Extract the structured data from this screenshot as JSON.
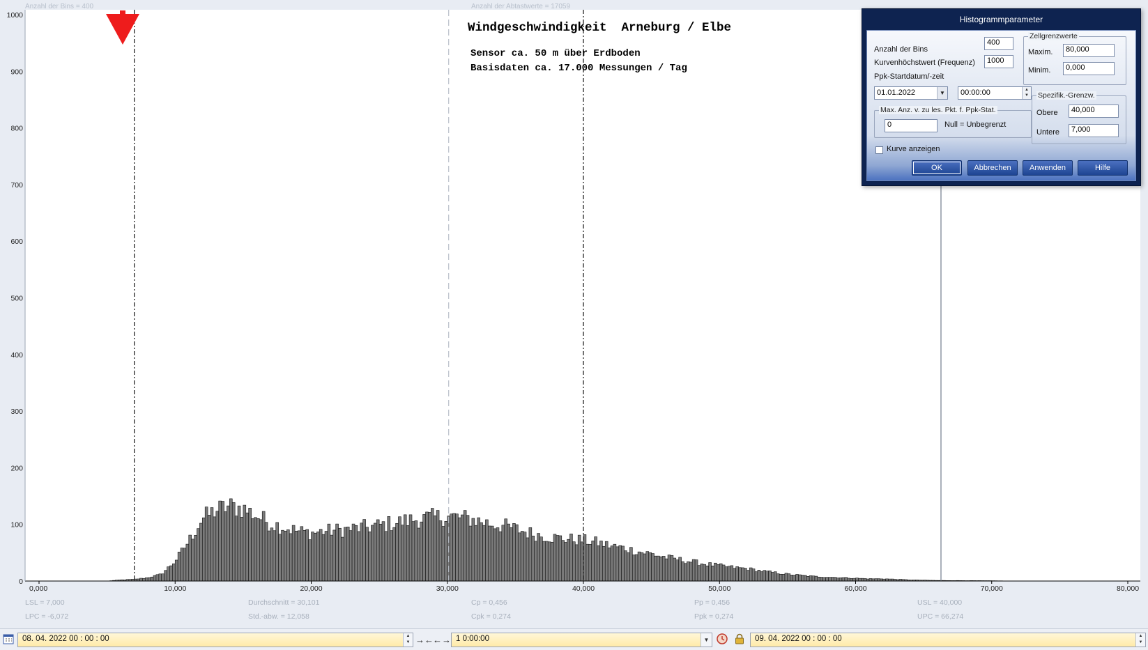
{
  "chart_data": {
    "type": "bar",
    "title": "Windgeschwindigkeit  Arneburg / Elbe",
    "subtitle_lines": [
      "Sensor ca. 50 m über Erdboden",
      "Basisdaten ca. 17.000 Messungen / Tag"
    ],
    "ghost_labels": {
      "bins": "Anzahl der Bins =   400",
      "samples": "Anzahl der Abtastwerte = 17059"
    },
    "xlim": [
      0,
      80
    ],
    "ylim": [
      0,
      1000
    ],
    "x_ticks": [
      0,
      10,
      20,
      30,
      40,
      50,
      60,
      70,
      80
    ],
    "x_tick_labels": [
      "0,000",
      "10,000",
      "20,000",
      "30,000",
      "40,000",
      "50,000",
      "60,000",
      "70,000",
      "80,000"
    ],
    "y_ticks": [
      0,
      100,
      200,
      300,
      400,
      500,
      600,
      700,
      800,
      900,
      1000
    ],
    "y_tick_labels": [
      "0",
      "100",
      "200",
      "300",
      "400",
      "500",
      "600",
      "700",
      "800",
      "900",
      "1000"
    ],
    "bin_width": 0.2,
    "profile": [
      [
        5,
        0
      ],
      [
        6,
        2
      ],
      [
        7,
        3
      ],
      [
        8,
        6
      ],
      [
        9,
        12
      ],
      [
        10,
        35
      ],
      [
        11,
        70
      ],
      [
        12,
        110
      ],
      [
        13,
        125
      ],
      [
        14,
        132
      ],
      [
        15,
        128
      ],
      [
        16,
        115
      ],
      [
        17,
        102
      ],
      [
        18,
        95
      ],
      [
        19,
        88
      ],
      [
        20,
        85
      ],
      [
        21,
        88
      ],
      [
        22,
        90
      ],
      [
        23,
        92
      ],
      [
        24,
        95
      ],
      [
        25,
        98
      ],
      [
        26,
        102
      ],
      [
        27,
        106
      ],
      [
        28,
        110
      ],
      [
        29,
        112
      ],
      [
        30,
        114
      ],
      [
        31,
        112
      ],
      [
        32,
        108
      ],
      [
        33,
        102
      ],
      [
        34,
        98
      ],
      [
        35,
        92
      ],
      [
        36,
        85
      ],
      [
        37,
        80
      ],
      [
        38,
        76
      ],
      [
        39,
        74
      ],
      [
        40,
        72
      ],
      [
        41,
        68
      ],
      [
        42,
        62
      ],
      [
        43,
        58
      ],
      [
        44,
        52
      ],
      [
        45,
        48
      ],
      [
        46,
        42
      ],
      [
        47,
        38
      ],
      [
        48,
        34
      ],
      [
        49,
        30
      ],
      [
        50,
        27
      ],
      [
        51,
        24
      ],
      [
        52,
        22
      ],
      [
        53,
        18
      ],
      [
        54,
        15
      ],
      [
        55,
        12
      ],
      [
        56,
        10
      ],
      [
        57,
        8
      ],
      [
        58,
        7
      ],
      [
        59,
        6
      ],
      [
        60,
        5
      ],
      [
        61,
        4
      ],
      [
        62,
        4
      ],
      [
        63,
        3
      ],
      [
        64,
        2
      ],
      [
        66,
        1
      ],
      [
        70,
        0.5
      ],
      [
        72,
        0
      ]
    ],
    "markers": [
      {
        "name": "LSL",
        "x": 7.0,
        "style": "dashdot"
      },
      {
        "name": "Mean",
        "x": 30.101,
        "style": "dashed"
      },
      {
        "name": "USL",
        "x": 40.0,
        "style": "dashdot"
      },
      {
        "name": "UPC",
        "x": 66.274,
        "style": "solid"
      }
    ],
    "stats": [
      [
        "LSL = 7,000",
        "LPC = -6,072"
      ],
      [
        "Durchschnitt  = 30,101",
        "Std.-abw. = 12,058"
      ],
      [
        "Cp  = 0,456",
        "Cpk = 0,274"
      ],
      [
        "Pp  = 0,456",
        "Ppk = 0,274"
      ],
      [
        "USL = 40,000",
        "UPC = 66,274"
      ]
    ]
  },
  "dialog": {
    "title": "Histogrammparameter",
    "bins_label": "Anzahl der Bins",
    "bins_value": "400",
    "curvemax_label": "Kurvenhöchstwert (Frequenz)",
    "curvemax_value": "1000",
    "ppk_start_label": "Ppk-Startdatum/-zeit",
    "ppk_date": "01.01.2022",
    "ppk_time": "00:00:00",
    "cell_group": "Zellgrenzwerte",
    "max_label": "Maxim.",
    "max_value": "80,000",
    "min_label": "Minim.",
    "min_value": "0,000",
    "maxpts_group": "Max. Anz. v. zu les. Pkt. f. Ppk-Stat.",
    "maxpts_value": "0",
    "null_hint": "Null = Unbegrenzt",
    "spec_group": "Spezifik.-Grenzw.",
    "upper_label": "Obere",
    "upper_value": "40,000",
    "lower_label": "Untere",
    "lower_value": "7,000",
    "show_curve_label": "Kurve anzeigen",
    "ok": "OK",
    "cancel": "Abbrechen",
    "apply": "Anwenden",
    "help": "Hilfe"
  },
  "bottombar": {
    "start": "08. 04. 2022    00 : 00 : 00",
    "duration": "1  0:00:00",
    "end": "09. 04. 2022    00 : 00 : 00"
  }
}
